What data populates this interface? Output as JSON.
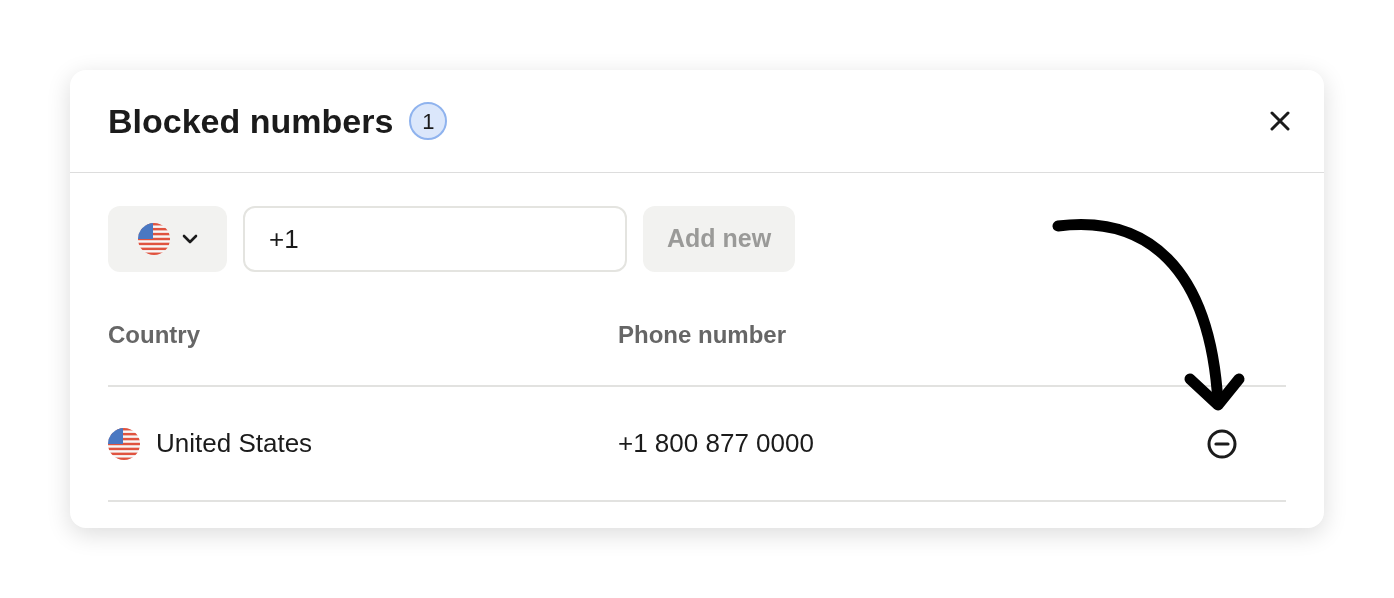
{
  "dialog": {
    "title": "Blocked numbers",
    "count": "1"
  },
  "form": {
    "phone_value": "+1",
    "add_button": {
      "label": "Add new",
      "disabled": true
    }
  },
  "table": {
    "columns": [
      "Country",
      "Phone number"
    ],
    "rows": [
      {
        "country": "United States",
        "phone": "+1 800 877 0000"
      }
    ]
  },
  "annotation": {
    "kind": "arrow"
  }
}
